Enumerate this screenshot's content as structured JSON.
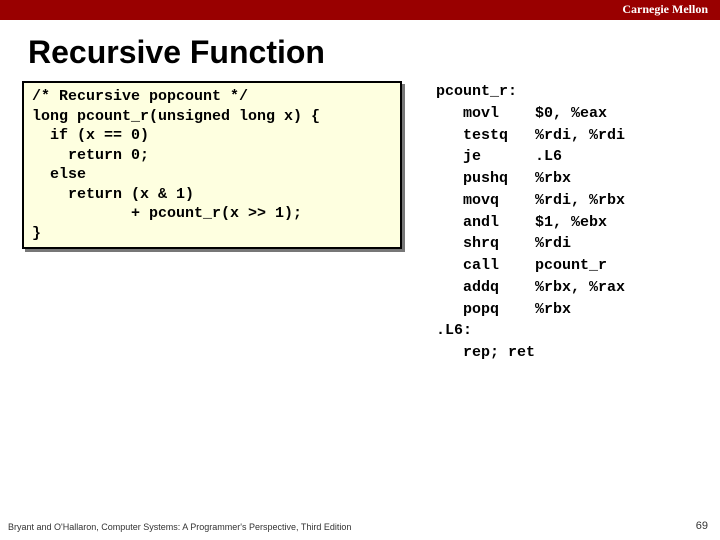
{
  "header": {
    "brand": "Carnegie Mellon"
  },
  "title": "Recursive Function",
  "code_c": "/* Recursive popcount */\nlong pcount_r(unsigned long x) {\n  if (x == 0)\n    return 0;\n  else\n    return (x & 1)\n           + pcount_r(x >> 1);\n}",
  "code_asm": "pcount_r:\n   movl    $0, %eax\n   testq   %rdi, %rdi\n   je      .L6\n   pushq   %rbx\n   movq    %rdi, %rbx\n   andl    $1, %ebx\n   shrq    %rdi\n   call    pcount_r\n   addq    %rbx, %rax\n   popq    %rbx\n.L6:\n   rep; ret",
  "footer": "Bryant and O'Hallaron, Computer Systems: A Programmer's Perspective, Third Edition",
  "page_number": "69"
}
